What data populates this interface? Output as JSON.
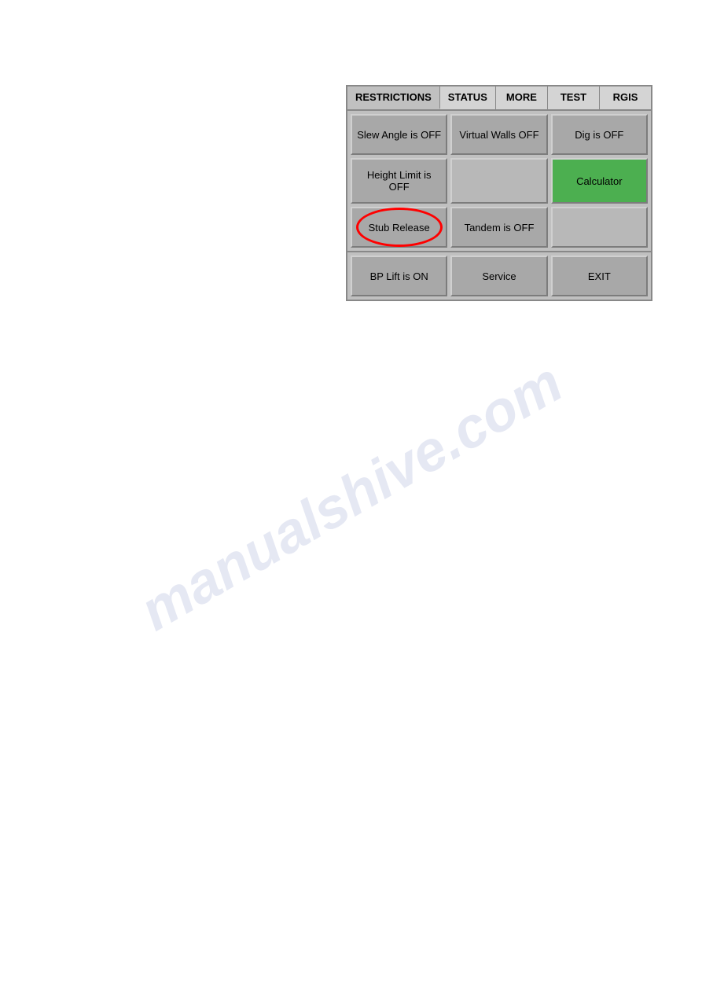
{
  "watermark": "manualshive.com",
  "tabs": [
    {
      "label": "RESTRICTIONS",
      "active": true
    },
    {
      "label": "STATUS",
      "active": false
    },
    {
      "label": "MORE",
      "active": false
    },
    {
      "label": "TEST",
      "active": false
    },
    {
      "label": "RGIS",
      "active": false
    }
  ],
  "buttons": [
    {
      "label": "Slew Angle is OFF",
      "style": "normal",
      "col": 1
    },
    {
      "label": "Virtual Walls OFF",
      "style": "normal",
      "col": 2
    },
    {
      "label": "Dig is OFF",
      "style": "normal",
      "col": 3
    },
    {
      "label": "Height Limit is OFF",
      "style": "normal",
      "col": 1
    },
    {
      "label": "",
      "style": "empty",
      "col": 2
    },
    {
      "label": "Calculator",
      "style": "green",
      "col": 3
    },
    {
      "label": "Stub Release",
      "style": "stub-release",
      "col": 1
    },
    {
      "label": "Tandem is OFF",
      "style": "normal",
      "col": 2
    },
    {
      "label": "",
      "style": "empty",
      "col": 3
    }
  ],
  "bottom_buttons": [
    {
      "label": "BP Lift is ON"
    },
    {
      "label": "Service"
    },
    {
      "label": "EXIT"
    }
  ]
}
